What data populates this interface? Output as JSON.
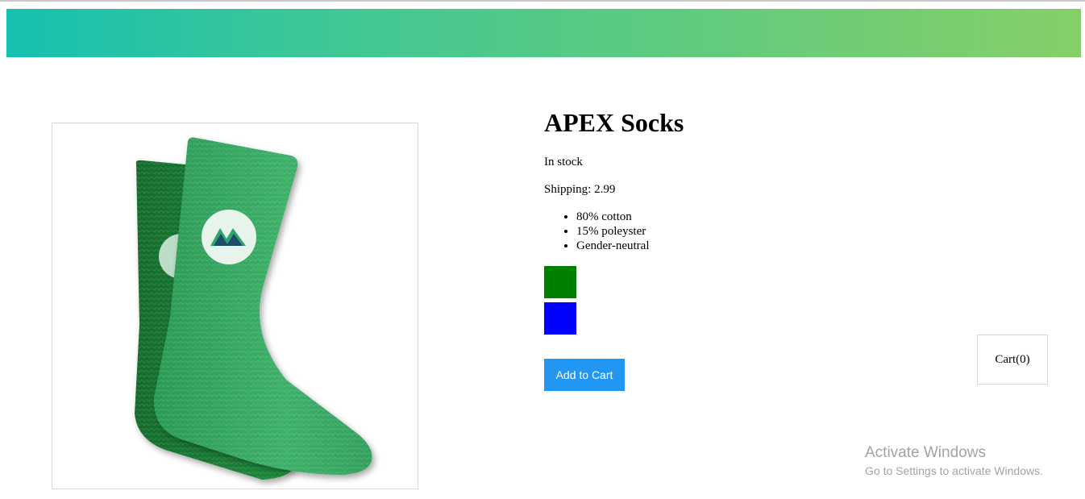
{
  "product": {
    "title": "APEX Socks",
    "stock_status": "In stock",
    "shipping_label": "Shipping: 2.99",
    "details": [
      "80% cotton",
      "15% poleyster",
      "Gender-neutral"
    ],
    "image_icon": "green-socks-image"
  },
  "variants": [
    {
      "color_name": "green",
      "color": "#008000"
    },
    {
      "color_name": "blue",
      "color": "#0000ff"
    }
  ],
  "actions": {
    "add_to_cart_label": "Add to Cart"
  },
  "cart": {
    "label": "Cart(0)"
  },
  "watermark": {
    "title": "Activate Windows",
    "subtitle": "Go to Settings to activate Windows."
  },
  "colors": {
    "nav_gradient_start": "#16c0b0",
    "nav_gradient_end": "#86cf68",
    "button_blue": "#2196f3"
  }
}
